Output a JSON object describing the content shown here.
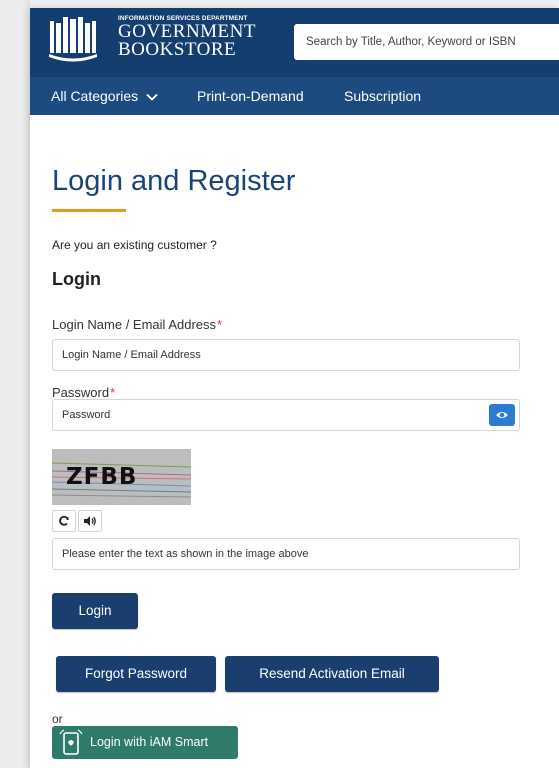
{
  "header": {
    "logo_small": "INFORMATION SERVICES DEPARTMENT",
    "logo_big": "GOVERNMENT\nBOOKSTORE",
    "search_placeholder": "Search by Title, Author, Keyword or ISBN"
  },
  "nav": {
    "items": [
      {
        "label": "All Categories"
      },
      {
        "label": "Print-on-Demand"
      },
      {
        "label": "Subscription"
      }
    ]
  },
  "page": {
    "title": "Login and Register",
    "existing_question": "Are you an existing customer ?",
    "login_heading": "Login",
    "accent_color": "#e29a1e"
  },
  "form": {
    "login_name": {
      "label": "Login Name / Email Address",
      "required_mark": "*",
      "placeholder": "Login Name / Email Address",
      "value": ""
    },
    "password": {
      "label": "Password",
      "required_mark": "*",
      "placeholder": "Password",
      "value": ""
    },
    "captcha": {
      "text": "ZFBB",
      "placeholder": "Please enter the text as shown in the image above",
      "value": ""
    }
  },
  "buttons": {
    "login": "Login",
    "forgot_password": "Forgot Password",
    "resend_activation": "Resend Activation Email",
    "or_text": "or",
    "iam_smart": "Login with iAM Smart"
  },
  "colors": {
    "header_bg": "#153e70",
    "nav_bg": "#1d4b80",
    "button_bg": "#1a3f6e",
    "iam_bg": "#2e7b6b",
    "required": "#d23b3b"
  }
}
